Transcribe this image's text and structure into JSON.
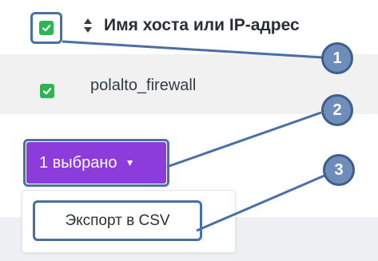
{
  "table": {
    "header": {
      "column_title": "Имя хоста или IP-адрес",
      "select_all_checked": true
    },
    "rows": [
      {
        "hostname": "polalto_firewall",
        "checked": true
      }
    ]
  },
  "bulk_actions": {
    "selected_label": "1 выбрано",
    "menu": [
      {
        "label": "Экспорт в CSV"
      }
    ]
  },
  "callouts": [
    "1",
    "2",
    "3"
  ],
  "colors": {
    "checkbox": "#2db552",
    "selection_button": "#8c3cdb",
    "annotation": "#4a6fa3",
    "callout_fill": "#6f8dba"
  },
  "icons": [
    "check-icon",
    "sort-icon",
    "caret-down-icon"
  ]
}
